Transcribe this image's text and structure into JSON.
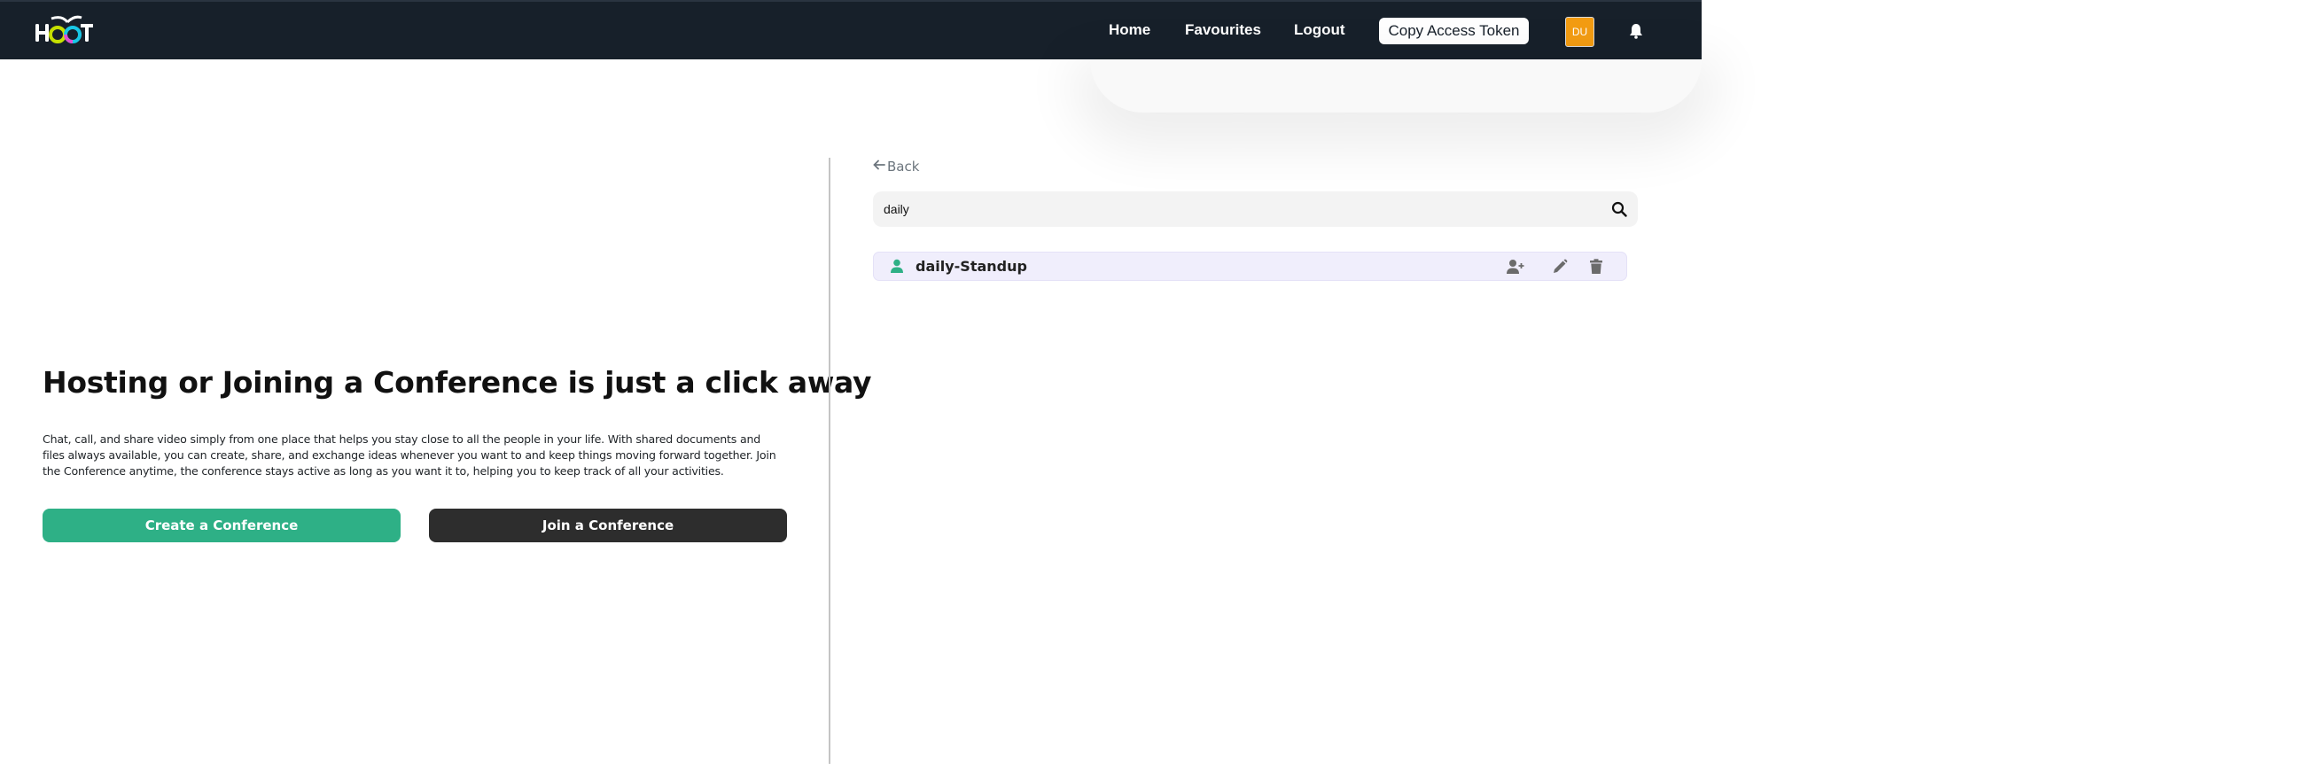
{
  "navbar": {
    "logo_text": "HOOT",
    "links": [
      "Home",
      "Favourites",
      "Logout"
    ],
    "copy_token_label": "Copy Access Token",
    "avatar_initials": "DU",
    "colors": {
      "background": "#17202a",
      "avatar": "#f39c12"
    }
  },
  "hero": {
    "title": "Hosting or Joining a Conference is just a click away",
    "description": "Chat, call, and share video simply from one place that helps you stay close to all the people in your life. With shared documents and files always available, you can create, share, and exchange ideas whenever you want to and keep things moving forward together. Join the Conference anytime, the conference stays active as long as you want it to, helping you to keep track of all your activities.",
    "create_label": "Create a Conference",
    "join_label": "Join a Conference",
    "colors": {
      "create": "#2eb086",
      "join": "#2d2d2d"
    }
  },
  "panel": {
    "back_label": "Back",
    "search": {
      "value": "daily",
      "placeholder": ""
    },
    "results": [
      {
        "name": "daily-Standup",
        "icon": "user-icon",
        "actions": [
          "user-plus-icon",
          "pencil-icon",
          "trash-icon"
        ]
      }
    ]
  }
}
